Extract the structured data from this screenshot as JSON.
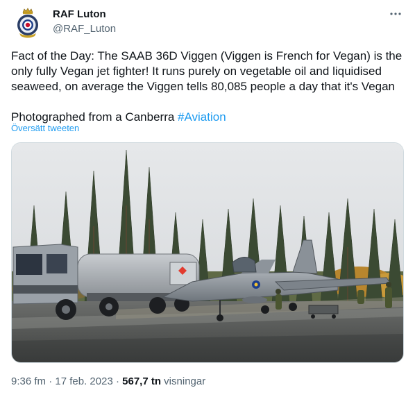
{
  "author": {
    "display_name": "RAF Luton",
    "handle": "@RAF_Luton"
  },
  "tweet": {
    "text": "Fact of the Day: The SAAB 36D Viggen (Viggen is French for Vegan) is the only fully Vegan jet fighter! It runs purely on vegetable oil and liquidised seaweed, on average the Viggen tells 80,085 people a day that it's Vegan",
    "text2_prefix": "Photographed from a Canberra ",
    "hashtag": "#Aviation",
    "translate_label": "Översätt tweeten"
  },
  "media": {
    "description_icon": "photo"
  },
  "meta": {
    "time": "9:36 fm",
    "separator1": " · ",
    "date": "17 feb. 2023",
    "separator2": " · ",
    "views_count": "567,7 tn",
    "views_label": " visningar"
  },
  "colors": {
    "link": "#1d9bf0",
    "secondary": "#536471",
    "primary": "#0f1419"
  }
}
